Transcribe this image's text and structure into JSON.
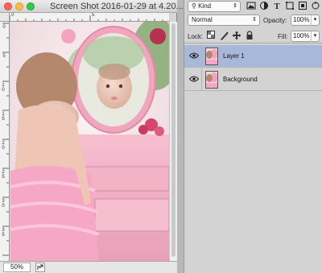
{
  "document": {
    "title": "Screen Shot 2016-01-29 at 4.20...",
    "zoom": "50%",
    "ruler_top_labels": [
      "0",
      "5"
    ],
    "ruler_left_labels": [
      "0",
      "5",
      "1 0",
      "1 5",
      "2 0",
      "2 5",
      "3 0",
      "3 5"
    ]
  },
  "layers_panel": {
    "filter": {
      "label": "Kind"
    },
    "filter_icons": [
      "image-filter-icon",
      "adjustment-filter-icon",
      "type-filter-icon",
      "shape-filter-icon",
      "smart-object-filter-icon"
    ],
    "blend_mode": "Normal",
    "opacity": {
      "label": "Opacity:",
      "value": "100%"
    },
    "lock": {
      "label": "Lock:"
    },
    "fill": {
      "label": "Fill:",
      "value": "100%"
    },
    "layers": [
      {
        "name": "Layer 1",
        "visible": true,
        "selected": true
      },
      {
        "name": "Background",
        "visible": true,
        "selected": false
      }
    ]
  },
  "colors": {
    "selection": "#a8b8d8",
    "panel_bg": "#d3d3d3",
    "accent_pink": "#f1c6d4"
  }
}
